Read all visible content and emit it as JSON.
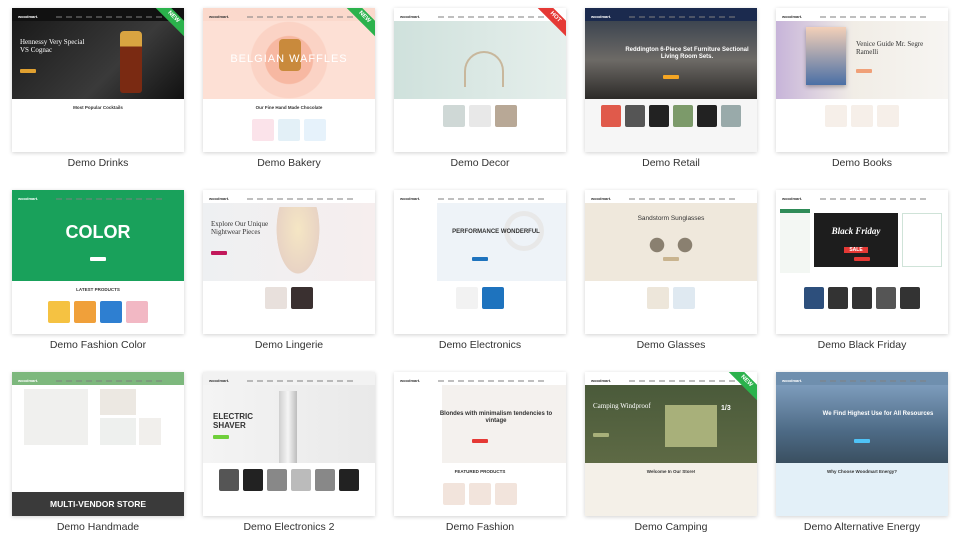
{
  "colors": {
    "new_badge": "#2bb24c",
    "hot_badge": "#e53935",
    "label": "#333333"
  },
  "demos": [
    {
      "label": "Demo Drinks",
      "badge": "NEW",
      "nav_bg": "#111111",
      "logo_color": "#ffffff",
      "hero_bg": "linear-gradient(135deg,#1a1a1a,#3a3a3a 60%,#111)",
      "hero_text": "Hennessy Very Special VS Cognac",
      "hero_color": "#ffffff",
      "hero_style": "serif-left",
      "btn": "#e0a030",
      "accent_shape": "bottle",
      "lower_bg": "#ffffff",
      "lower_text": "Most Popular Cocktails",
      "tiles": []
    },
    {
      "label": "Demo Bakery",
      "badge": "NEW",
      "nav_bg": "#fbd9cc",
      "logo_color": "#333333",
      "hero_bg": "radial-gradient(circle at 50% 50%,#f7b8a2 0 25%,#fbd3c5 26% 40%,#fde0d5 41%)",
      "hero_text": "BELGIAN WAFFLES",
      "hero_color": "#ffffff",
      "hero_style": "wide-center",
      "btn": "",
      "accent_shape": "waffle",
      "lower_bg": "#ffffff",
      "lower_text": "Our Fine Hand Made Chocolate",
      "tiles": [
        "#fbe3ea",
        "#e3f0f7",
        "#e6f2fb"
      ]
    },
    {
      "label": "Demo Decor",
      "badge": "HOT",
      "nav_bg": "#ffffff",
      "logo_color": "#333333",
      "hero_bg": "linear-gradient(90deg,#cfe1dc,#e6efec)",
      "hero_text": "",
      "hero_color": "#333333",
      "hero_style": "serif-left",
      "btn": "",
      "accent_shape": "lamp",
      "lower_bg": "#ffffff",
      "lower_text": "",
      "tiles": [
        "#cfd8d6",
        "#e8e8e8",
        "#b8a896"
      ]
    },
    {
      "label": "Demo Retail",
      "badge": "",
      "nav_bg": "#1b2a4e",
      "logo_color": "#ffffff",
      "hero_bg": "linear-gradient(180deg,#3d4550,#6d6a66 50%,#2c2a28)",
      "hero_text": "Reddington 6-Piece Set Furniture Sectional Living Room Sets.",
      "hero_color": "#ffffff",
      "hero_style": "center",
      "btn": "#f5a623",
      "accent_shape": "",
      "lower_bg": "#f6f6f6",
      "lower_text": "",
      "tiles": [
        "#e05a4b",
        "#555",
        "#222",
        "#7c9a6a",
        "#222",
        "#9aa"
      ]
    },
    {
      "label": "Demo Books",
      "badge": "",
      "nav_bg": "#ffffff",
      "logo_color": "#333333",
      "hero_bg": "linear-gradient(90deg,#c7b4d9,#f1ede6 45%,#f7f5f2)",
      "hero_text": "Venice Guide Mr. Segre Ramelli",
      "hero_color": "#333333",
      "hero_style": "serif-right",
      "btn": "#f0a078",
      "accent_shape": "book",
      "lower_bg": "#ffffff",
      "lower_text": "",
      "tiles": [
        "#f6efe9",
        "#f6efe9",
        "#f6efe9"
      ]
    },
    {
      "label": "Demo Fashion Color",
      "badge": "",
      "nav_bg": "#19a15b",
      "logo_color": "#ffffff",
      "hero_bg": "#19a15b",
      "hero_text": "COLOR",
      "hero_color": "#ffffff",
      "hero_style": "big-center",
      "btn": "#ffffff",
      "accent_shape": "",
      "lower_bg": "#ffffff",
      "lower_text": "LATEST PRODUCTS",
      "tiles": [
        "#f5c242",
        "#f0a03a",
        "#2e7fd1",
        "#f2b8c4"
      ]
    },
    {
      "label": "Demo Lingerie",
      "badge": "",
      "nav_bg": "#ffffff",
      "logo_color": "#333333",
      "hero_bg": "linear-gradient(90deg,#eef0f2,#f6eeee)",
      "hero_text": "Explore Our Unique Nightwear Pieces",
      "hero_color": "#333333",
      "hero_style": "serif-left",
      "btn": "#c2185b",
      "accent_shape": "figure",
      "lower_bg": "#ffffff",
      "lower_text": "",
      "tiles": [
        "#e8e0dc",
        "#3a3030"
      ]
    },
    {
      "label": "Demo Electronics",
      "badge": "",
      "nav_bg": "#ffffff",
      "logo_color": "#333333",
      "hero_bg": "linear-gradient(90deg,#ffffff 25%,#eef3f8 25%)",
      "hero_text": "PERFORMANCE WONDERFUL",
      "hero_color": "#333333",
      "hero_style": "center",
      "btn": "#1e73be",
      "accent_shape": "phone",
      "lower_bg": "#ffffff",
      "lower_text": "",
      "tiles": [
        "#f2f2f2",
        "#1e73be"
      ]
    },
    {
      "label": "Demo Glasses",
      "badge": "",
      "nav_bg": "#ffffff",
      "logo_color": "#333333",
      "hero_bg": "#efe8dc",
      "hero_text": "Sandstorm Sunglasses",
      "hero_color": "#333333",
      "hero_style": "top-center",
      "btn": "#c9b48f",
      "accent_shape": "glasses",
      "lower_bg": "#ffffff",
      "lower_text": "",
      "tiles": [
        "#ede6da",
        "#dfe9f1"
      ]
    },
    {
      "label": "Demo Black Friday",
      "badge": "",
      "nav_bg": "#ffffff",
      "logo_color": "#333333",
      "hero_bg": "#ffffff",
      "hero_text": "Black Friday",
      "hero_color": "#ffffff",
      "hero_style": "bf",
      "btn": "#e53935",
      "accent_shape": "",
      "lower_bg": "#ffffff",
      "lower_text": "",
      "tiles": [
        "#2d4f7c",
        "#333",
        "#333",
        "#555",
        "#333"
      ]
    },
    {
      "label": "Demo Handmade",
      "badge": "",
      "nav_bg": "#7db87d",
      "logo_color": "#ffffff",
      "hero_bg": "#ffffff",
      "hero_text": "MULTI-VENDOR STORE",
      "hero_color": "#ffffff",
      "hero_style": "mv",
      "btn": "",
      "accent_shape": "",
      "lower_bg": "#ffffff",
      "lower_text": "",
      "tiles": []
    },
    {
      "label": "Demo Electronics 2",
      "badge": "",
      "nav_bg": "#f2f2f2",
      "logo_color": "#333333",
      "hero_bg": "linear-gradient(90deg,#f4f4f4,#e9e9e9)",
      "hero_text": "ELECTRIC SHAVER",
      "hero_color": "#333333",
      "hero_style": "left",
      "btn": "#6fcf3b",
      "accent_shape": "shaver",
      "lower_bg": "#ffffff",
      "lower_text": "",
      "tiles": [
        "#555",
        "#222",
        "#888",
        "#bbb",
        "#888",
        "#222"
      ]
    },
    {
      "label": "Demo Fashion",
      "badge": "",
      "nav_bg": "#ffffff",
      "logo_color": "#333333",
      "hero_bg": "linear-gradient(90deg,#ffffff 28%,#f4f1ee 28%)",
      "hero_text": "Blondes with minimalism tendencies to vintage",
      "hero_color": "#333333",
      "hero_style": "center",
      "btn": "#e53935",
      "accent_shape": "",
      "lower_bg": "#ffffff",
      "lower_text": "FEATURED PRODUCTS",
      "tiles": [
        "#f2e4dc",
        "#f2e4dc",
        "#f2e4dc"
      ]
    },
    {
      "label": "Demo Camping",
      "badge": "NEW",
      "nav_bg": "#ffffff",
      "logo_color": "#333333",
      "hero_bg": "linear-gradient(180deg,#4a5a3a,#5e6a45)",
      "hero_text": "Camping Windproof",
      "hero_color": "#ffffff",
      "hero_style": "serif-left",
      "btn": "#a8b07a",
      "accent_shape": "tent",
      "lower_bg": "#f4f0e8",
      "lower_text": "Welcome In Our Store!",
      "tiles": []
    },
    {
      "label": "Demo Alternative Energy",
      "badge": "",
      "nav_bg": "#6f8fae",
      "logo_color": "#ffffff",
      "hero_bg": "linear-gradient(180deg,#7d9cbc,#4d6a85 60%,#3a4f60)",
      "hero_text": "We Find Highest Use for All Resources",
      "hero_color": "#ffffff",
      "hero_style": "center",
      "btn": "#4fc3f7",
      "accent_shape": "",
      "lower_bg": "#e3f0f8",
      "lower_text": "Why Choose Woodmart Energy?",
      "tiles": []
    }
  ],
  "extras": {
    "camping_counter": "1/3",
    "logo_text": "woodmart.",
    "bf_sale": "SALE"
  }
}
